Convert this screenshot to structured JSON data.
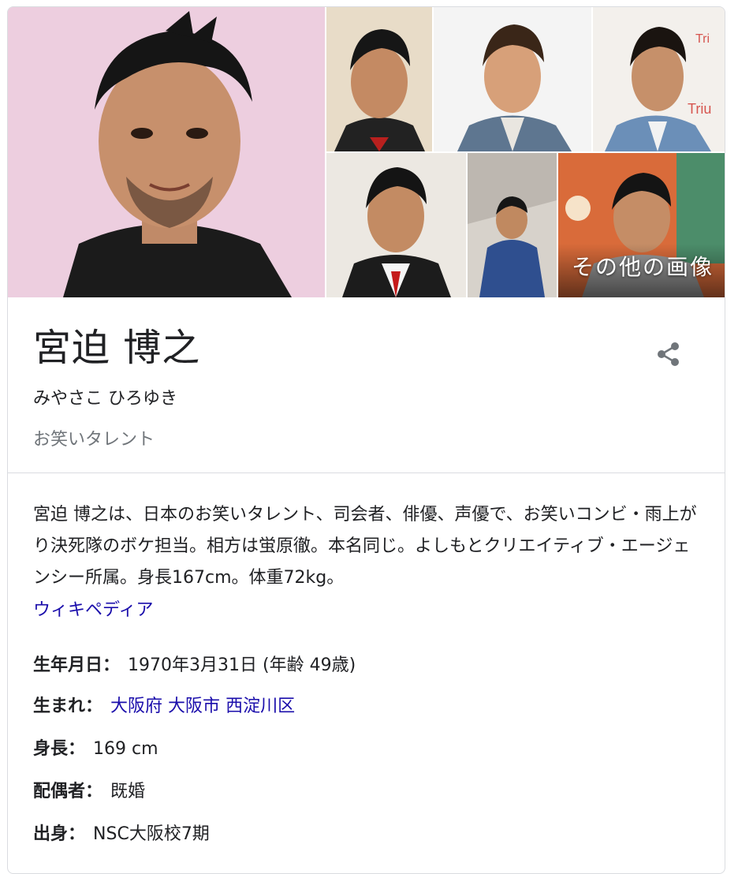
{
  "images": {
    "main": "person-photo-icon",
    "more_label": "その他の画像"
  },
  "header": {
    "title": "宮迫 博之",
    "reading": "みやさこ ひろゆき",
    "subtitle": "お笑いタレント",
    "share_icon": "share-icon"
  },
  "description": {
    "text": "宮迫 博之は、日本のお笑いタレント、司会者、俳優、声優で、お笑いコンビ・雨上がり決死隊のボケ担当。相方は蛍原徹。本名同じ。よしもとクリエイティブ・エージェンシー所属。身長167cm。体重72kg。",
    "source_link": "ウィキペディア"
  },
  "facts": {
    "birth": {
      "label": "生年月日",
      "value": "1970年3月31日 (年齢 49歳)"
    },
    "born": {
      "label": "生まれ",
      "links": [
        "大阪府",
        "大阪市",
        "西淀川区"
      ]
    },
    "height": {
      "label": "身長",
      "value": "169 cm"
    },
    "spouse": {
      "label": "配偶者",
      "value": "既婚"
    },
    "origin": {
      "label": "出身",
      "value": "NSC大阪校7期"
    },
    "separator": "："
  },
  "colors": {
    "link": "#1a0dab",
    "secondary_text": "#70757a",
    "border": "#dadce0"
  }
}
